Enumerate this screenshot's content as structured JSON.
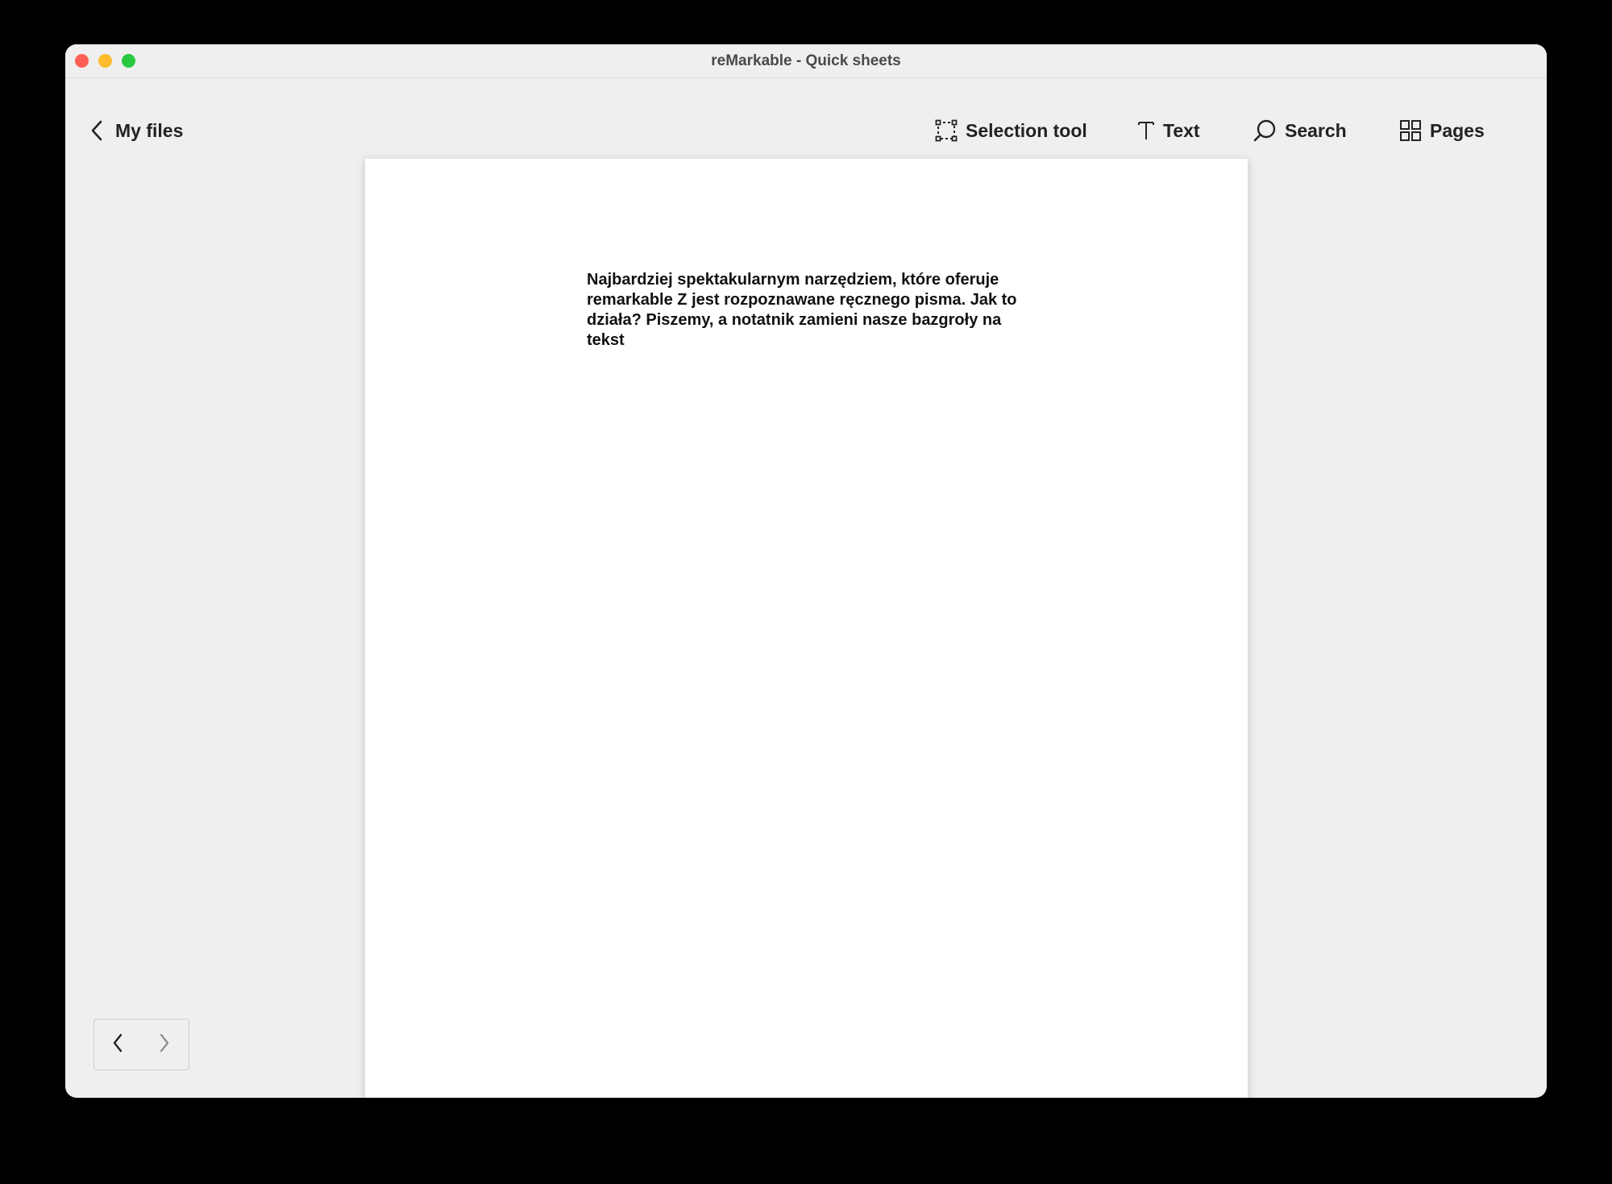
{
  "window": {
    "title": "reMarkable - Quick sheets"
  },
  "toolbar": {
    "back_label": "My files",
    "selection_label": "Selection tool",
    "text_label": "Text",
    "search_label": "Search",
    "pages_label": "Pages"
  },
  "document": {
    "text": "Najbardziej spektakularnym narzędziem, które oferuje remarkable Z jest rozpoznawane ręcznego pisma. Jak to działa? Piszemy, a notatnik zamieni nasze bazgroły na tekst"
  },
  "icons": {
    "back": "chevron-left-icon",
    "selection": "selection-marquee-icon",
    "text": "text-cursor-icon",
    "search": "search-icon",
    "pages": "grid-icon",
    "prev": "chevron-left-icon",
    "next": "chevron-right-icon"
  },
  "colors": {
    "close": "#fe5f57",
    "minimize": "#febc2e",
    "zoom": "#28c840",
    "background": "#efefef",
    "page": "#ffffff"
  }
}
